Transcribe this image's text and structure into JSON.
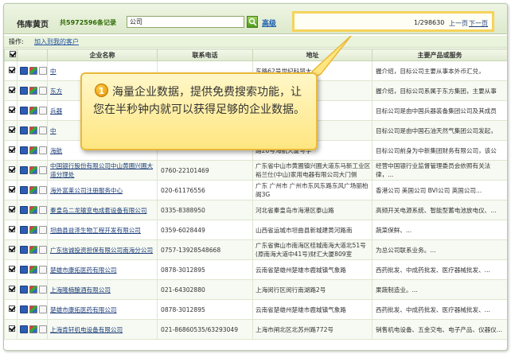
{
  "header": {
    "title": "伟库黄页",
    "record_count": "共5972596条记录",
    "search_value": "公司",
    "advanced_link": "高级"
  },
  "pager": {
    "count": "1/298630",
    "prev": "上一页",
    "next": "下一页"
  },
  "ops": {
    "label": "操作:",
    "add_link": "加入到我的客户"
  },
  "columns": {
    "name": "企业名称",
    "phone": "联系电话",
    "address": "地址",
    "products": "主要产品或服务"
  },
  "rows": [
    {
      "name": "中",
      "phone": "",
      "address": "东路62号世纪科贸大",
      "products": "握介绍，目标公司主要从事本外币汇兑，"
    },
    {
      "name": "东方",
      "phone": "",
      "address": "区花园街235号东",
      "products": "握介绍，目标公司系属于东方集团，主要从事"
    },
    {
      "name": "兵器",
      "phone": "",
      "address": "69号中国兵器大厦",
      "products": "目标公司是由中国兵器装备集团公司及其成员"
    },
    {
      "name": "中",
      "phone": "",
      "address": "大街5号",
      "products": "目标公司是由中国石油天然气集团公司发起，"
    },
    {
      "name": "海航",
      "phone": "",
      "address": "路26号海航大厦写字",
      "products": "目标公司前身为中新集团财务有限公司，该公"
    },
    {
      "name": "中国银行股份有限公司中山黄圃兴圃大道分理处",
      "phone": "0760-22101469",
      "address": "广东省中山市黄圃镇兴圃大道东马新工业区裕兰仕(中山)家用电器有限公司大门侧",
      "products": "经营中国银行业监督管理委员会依照有关法律，..."
    },
    {
      "name": "海外富莱公司注册服务中心",
      "phone": "020-61176556",
      "address": "广东 广州市 广州市东风东路东风广场丽柏阁3G",
      "products": "香港公司 美国公司 BVI公司 英国公司..."
    },
    {
      "name": "秦皇岛二龙输变电成套设备有限公司",
      "phone": "0335-8388950",
      "address": "河北省秦皇岛市海港区泰山路",
      "products": "高频开关电源系统、智能型蓄电池放电仪、..."
    },
    {
      "name": "坦曲县益泽生物工程开发有限公司",
      "phone": "0359-6028449",
      "address": "山西省运城市坦曲县新城建黄河路南",
      "products": "蔬菜保鲜、..."
    },
    {
      "name": "广东信诚投资担保有限公司南海分公司",
      "phone": "0757-13928548668",
      "address": "广东省佛山市南海区桂城南海大道北51号(原南海大道中41号)财汇大厦809室",
      "products": "为总公司联系业务。..."
    },
    {
      "name": "楚雄市康拓医药有限公司",
      "phone": "0878-3012895",
      "address": "云南省楚雄州楚雄市鹿城镇气象路",
      "products": "西药批发、中成药批发、医疗器械批发、..."
    },
    {
      "name": "上海隆楠酿酒有限公司",
      "phone": "021-64302880",
      "address": "上海闵行区闵行南湖路2号",
      "products": "果蔬制造业。..."
    },
    {
      "name": "楚雄市康拓医药有限公司",
      "phone": "0878-3012895",
      "address": "云南省楚雄州楚雄市鹿城镇气象路",
      "products": "西药批发、中成药批发、医疗器械批发、..."
    },
    {
      "name": "上海肯轩机电设备有限公司",
      "phone": "021-86860535/63293049",
      "address": "上海市闸北区北苏州路772号",
      "products": "销售机电设备、五金交电、电子产品、仪器仪..."
    }
  ],
  "callout": {
    "number": "1",
    "text": "海量企业数据，提供免费搜索功能，让您在半秒钟内就可以获得足够的企业数据。"
  },
  "colors": {
    "pager_border": "#f6d35a",
    "callout_bg": "#ffe680",
    "link": "#1b3d7a"
  }
}
